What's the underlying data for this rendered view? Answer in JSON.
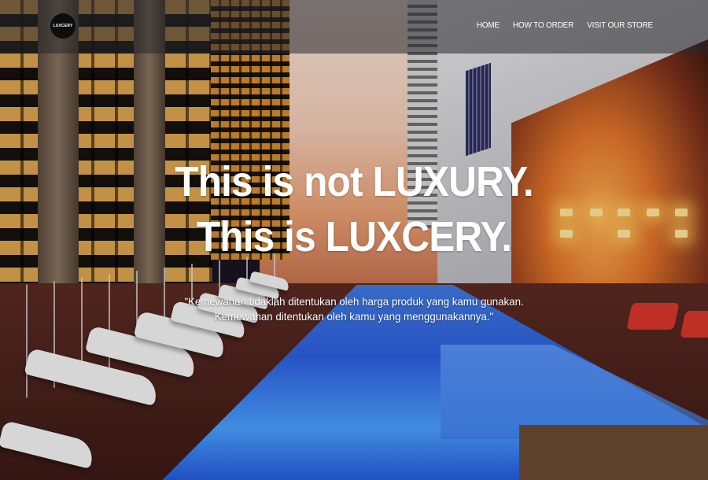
{
  "nav": {
    "logo_text": "LUXCERY",
    "links": [
      {
        "label": "HOME"
      },
      {
        "label": "HOW TO ORDER"
      },
      {
        "label": "VISIT OUR STORE"
      }
    ]
  },
  "hero": {
    "line1": "This is not LUXURY.",
    "line2": "This is LUXCERY."
  },
  "quote": {
    "line1": "\"Kemewahan tidaklah ditentukan oleh harga produk yang kamu gunakan.",
    "line2": "Kemewahan ditentukan oleh kamu yang menggunakannya.\""
  },
  "colors": {
    "navbar": "#28282c",
    "text": "#ffffff",
    "logo_bg": "#0d0d0d"
  }
}
